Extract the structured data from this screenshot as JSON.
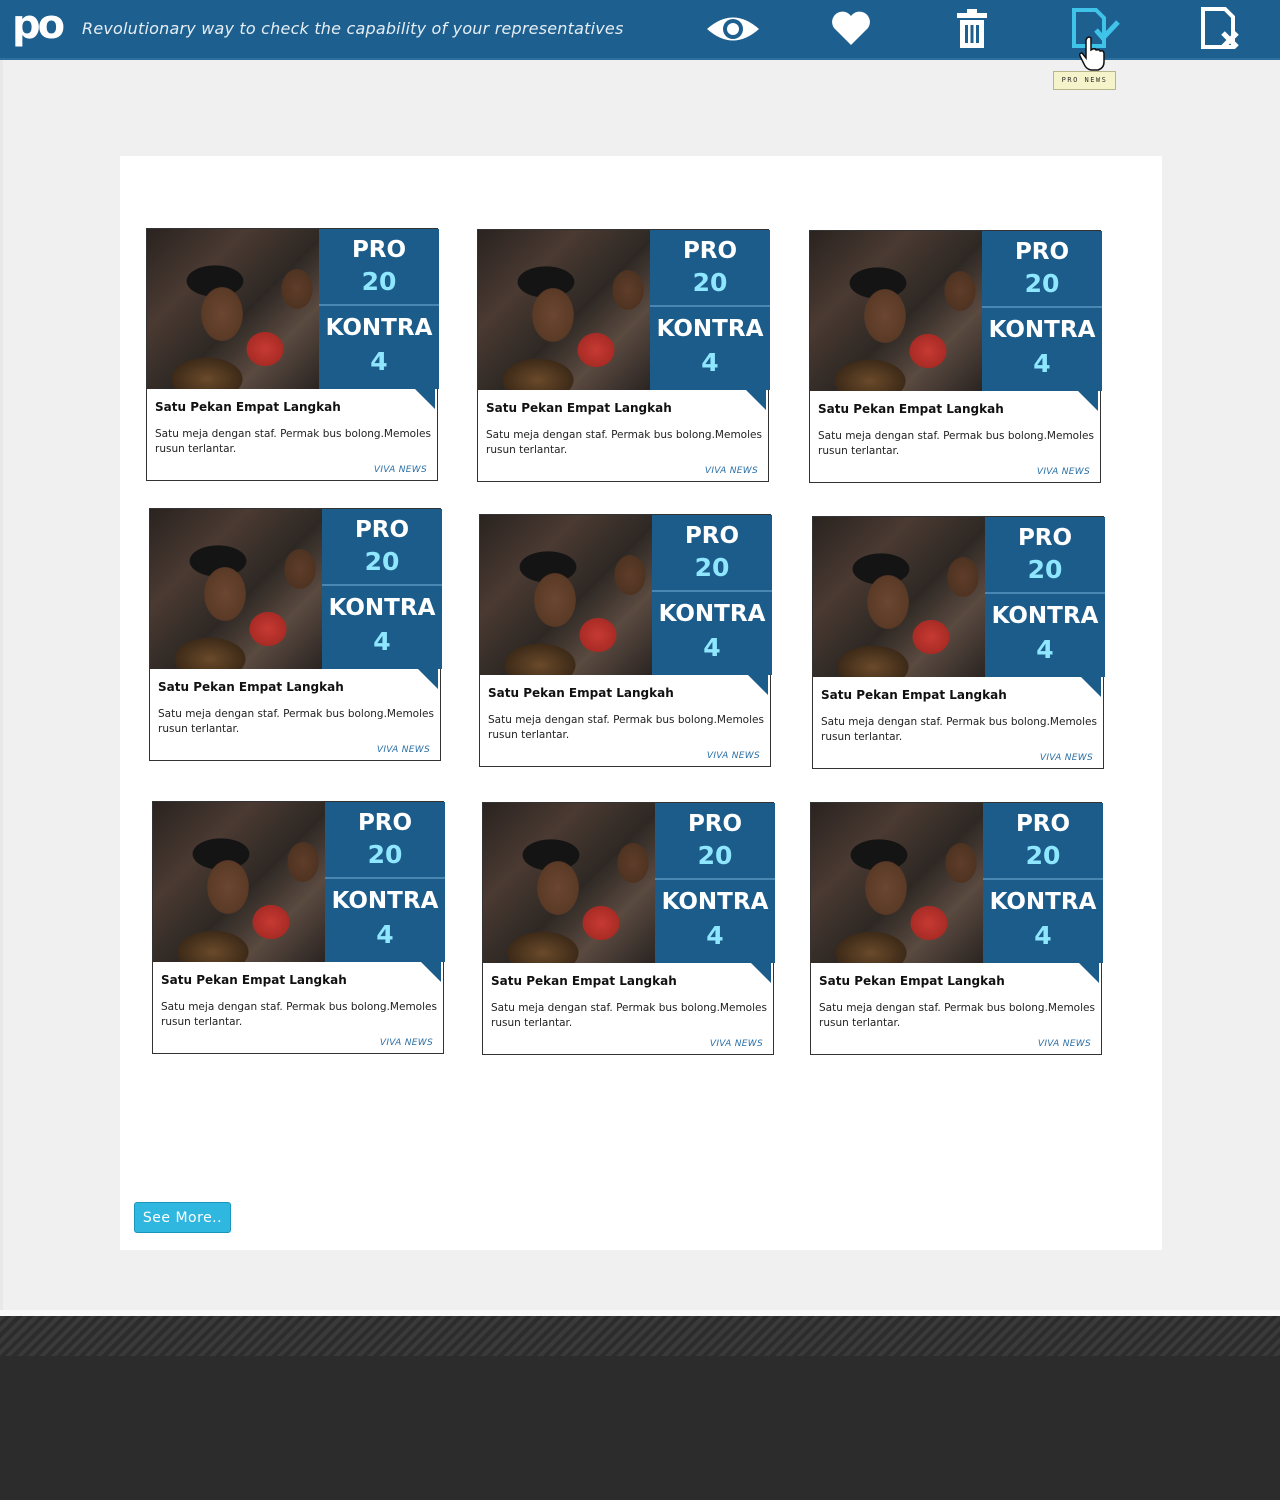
{
  "header": {
    "logo": "po",
    "tagline": "Revolutionary way to check the capability of your representatives",
    "icons": [
      {
        "name": "eye-icon",
        "active": false
      },
      {
        "name": "heart-icon",
        "active": false
      },
      {
        "name": "trash-icon",
        "active": false
      },
      {
        "name": "doc-check-icon",
        "active": true
      },
      {
        "name": "doc-x-icon",
        "active": false
      }
    ],
    "tooltip": "PRO NEWS"
  },
  "colors": {
    "header_bg": "#1d5f8e",
    "score_panel": "#1c5c8b",
    "score_value": "#8fe7ff",
    "accent_active": "#3fc3e8",
    "button": "#2fb7e0"
  },
  "cards": [
    {
      "pro_label": "PRO",
      "pro_value": "20",
      "kontra_label": "KONTRA",
      "kontra_value": "4",
      "title": "Satu Pekan Empat Langkah",
      "description": "Satu meja dengan staf. Permak bus bolong.Memoles rusun terlantar.",
      "source": "VIVA NEWS"
    },
    {
      "pro_label": "PRO",
      "pro_value": "20",
      "kontra_label": "KONTRA",
      "kontra_value": "4",
      "title": "Satu Pekan Empat Langkah",
      "description": "Satu meja dengan staf. Permak bus bolong.Memoles rusun terlantar.",
      "source": "VIVA NEWS"
    },
    {
      "pro_label": "PRO",
      "pro_value": "20",
      "kontra_label": "KONTRA",
      "kontra_value": "4",
      "title": "Satu Pekan Empat Langkah",
      "description": "Satu meja dengan staf. Permak bus bolong.Memoles rusun terlantar.",
      "source": "VIVA NEWS"
    },
    {
      "pro_label": "PRO",
      "pro_value": "20",
      "kontra_label": "KONTRA",
      "kontra_value": "4",
      "title": "Satu Pekan Empat Langkah",
      "description": "Satu meja dengan staf. Permak bus bolong.Memoles rusun terlantar.",
      "source": "VIVA NEWS"
    },
    {
      "pro_label": "PRO",
      "pro_value": "20",
      "kontra_label": "KONTRA",
      "kontra_value": "4",
      "title": "Satu Pekan Empat Langkah",
      "description": "Satu meja dengan staf. Permak bus bolong.Memoles rusun terlantar.",
      "source": "VIVA NEWS"
    },
    {
      "pro_label": "PRO",
      "pro_value": "20",
      "kontra_label": "KONTRA",
      "kontra_value": "4",
      "title": "Satu Pekan Empat Langkah",
      "description": "Satu meja dengan staf. Permak bus bolong.Memoles rusun terlantar.",
      "source": "VIVA NEWS"
    },
    {
      "pro_label": "PRO",
      "pro_value": "20",
      "kontra_label": "KONTRA",
      "kontra_value": "4",
      "title": "Satu Pekan Empat Langkah",
      "description": "Satu meja dengan staf. Permak bus bolong.Memoles rusun terlantar.",
      "source": "VIVA NEWS"
    },
    {
      "pro_label": "PRO",
      "pro_value": "20",
      "kontra_label": "KONTRA",
      "kontra_value": "4",
      "title": "Satu Pekan Empat Langkah",
      "description": "Satu meja dengan staf. Permak bus bolong.Memoles rusun terlantar.",
      "source": "VIVA NEWS"
    },
    {
      "pro_label": "PRO",
      "pro_value": "20",
      "kontra_label": "KONTRA",
      "kontra_value": "4",
      "title": "Satu Pekan Empat Langkah",
      "description": "Satu meja dengan staf. Permak bus bolong.Memoles rusun terlantar.",
      "source": "VIVA NEWS"
    }
  ],
  "see_more_label": "See More.."
}
